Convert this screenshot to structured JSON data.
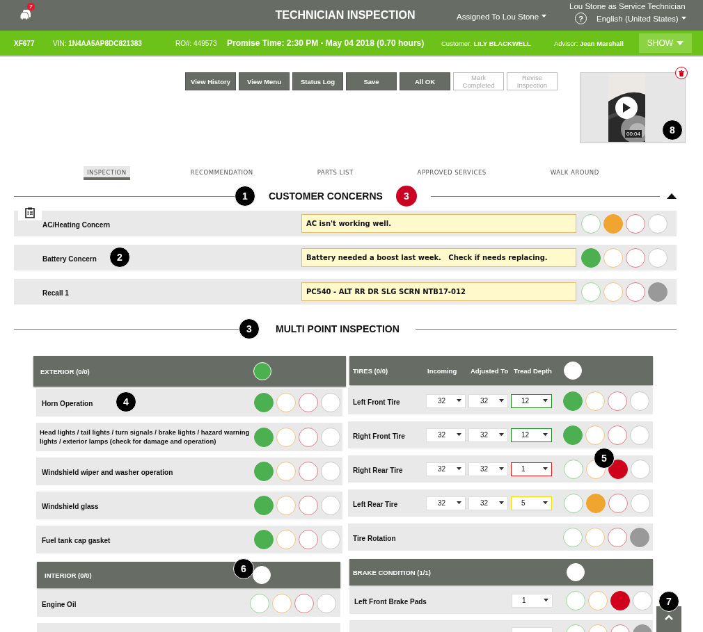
{
  "header": {
    "notifications": "7",
    "title": "TECHNICIAN INSPECTION",
    "assigned": "Assigned To Lou Stone",
    "user": "Lou Stone as Service Technician",
    "help": "?",
    "language": "English (United States)"
  },
  "info_bar": {
    "tag": "XF677",
    "vin": "VIN: **1N4AA5AP8DC821383**",
    "ro": "RO#: 449573",
    "promise": "Promise Time: 2:30 PM - May 04 2018 (0.70 hours)",
    "customer": "Customer: **LILY BLACKWELL**",
    "advisor": "Advisor: **Jean Marshall**",
    "show": "SHOW"
  },
  "actions": [
    {
      "label": "View History",
      "disabled": false
    },
    {
      "label": "View Menu",
      "disabled": false
    },
    {
      "label": "Status Log",
      "disabled": false
    },
    {
      "label": "Save",
      "disabled": false
    },
    {
      "label": "All OK",
      "disabled": false
    },
    {
      "label": "Mark Completed",
      "disabled": true
    },
    {
      "label": "Revise Inspection",
      "disabled": true
    }
  ],
  "video": {
    "duration": "00:04",
    "callout": "8"
  },
  "tabs": [
    {
      "label": "INSPECTION",
      "selected": true
    },
    {
      "label": "RECOMMENDATION",
      "selected": false
    },
    {
      "label": "PARTS LIST",
      "selected": false
    },
    {
      "label": "APPROVED SERVICES",
      "selected": false
    },
    {
      "label": "WALK AROUND",
      "selected": false
    }
  ],
  "concerns": {
    "title": "CUSTOMER CONCERNS",
    "callout": "1",
    "count": "3",
    "expanded": true,
    "items": [
      {
        "name": "AC/Heating Concern",
        "note": "AC isn't working well.",
        "ratings": [
          {
            "kind": "good",
            "selected": false
          },
          {
            "kind": "warning",
            "selected": true
          },
          {
            "kind": "urgent",
            "selected": false
          },
          {
            "kind": "na",
            "selected": false
          }
        ]
      },
      {
        "name": "Battery Concern",
        "note": "Battery needed a boost last week.   Check if needs replacing.",
        "callout": "2",
        "ratings": [
          {
            "kind": "good",
            "selected": true
          },
          {
            "kind": "warning",
            "selected": false
          },
          {
            "kind": "urgent",
            "selected": false
          },
          {
            "kind": "na",
            "selected": false
          }
        ]
      },
      {
        "name": "Recall 1",
        "note": "PC540 - ALT RR DR SLG SCRN NTB17-012",
        "ratings": [
          {
            "kind": "good",
            "selected": false
          },
          {
            "kind": "warning",
            "selected": false
          },
          {
            "kind": "urgent",
            "selected": false
          },
          {
            "kind": "na",
            "selected": true
          }
        ]
      }
    ]
  },
  "mpi": {
    "title": "MULTI POINT INSPECTION",
    "callout": "3"
  },
  "exterior": {
    "title": "EXTERIOR (0/0)",
    "color": "#4caf50",
    "items": [
      {
        "name": "Horn Operation",
        "callout": "4",
        "ratings": [
          {
            "kind": "good",
            "selected": true
          },
          {
            "kind": "warning",
            "selected": false
          },
          {
            "kind": "urgent",
            "selected": false
          },
          {
            "kind": "na",
            "selected": false
          }
        ]
      },
      {
        "name": "Head lights / tail lights / turn signals / brake lights / hazard warning lights / exterior lamps (check for damage and operation)",
        "ratings": [
          {
            "kind": "good",
            "selected": true
          },
          {
            "kind": "warning",
            "selected": false
          },
          {
            "kind": "urgent",
            "selected": false
          },
          {
            "kind": "na",
            "selected": false
          }
        ]
      },
      {
        "name": "Windshield wiper and washer operation",
        "ratings": [
          {
            "kind": "good",
            "selected": true
          },
          {
            "kind": "warning",
            "selected": false
          },
          {
            "kind": "urgent",
            "selected": false
          },
          {
            "kind": "na",
            "selected": false
          }
        ]
      },
      {
        "name": "Windshield glass",
        "ratings": [
          {
            "kind": "good",
            "selected": true
          },
          {
            "kind": "warning",
            "selected": false
          },
          {
            "kind": "urgent",
            "selected": false
          },
          {
            "kind": "na",
            "selected": false
          }
        ]
      },
      {
        "name": "Fuel tank cap gasket",
        "ratings": [
          {
            "kind": "good",
            "selected": true
          },
          {
            "kind": "warning",
            "selected": false
          },
          {
            "kind": "urgent",
            "selected": false
          },
          {
            "kind": "na",
            "selected": false
          }
        ]
      }
    ]
  },
  "interior": {
    "title": "INTERIOR (0/0)",
    "color": "#ffffff",
    "callout": "6",
    "items": [
      {
        "name": "Engine Oil",
        "ratings": [
          {
            "kind": "good",
            "selected": false
          },
          {
            "kind": "warning",
            "selected": false
          },
          {
            "kind": "urgent",
            "selected": false
          },
          {
            "kind": "na",
            "selected": false
          }
        ]
      }
    ]
  },
  "tires": {
    "title": "TIRES (0/0)",
    "columns": [
      "Incoming",
      "Adjusted To",
      "Tread Depth"
    ],
    "color": "#ffffff",
    "items": [
      {
        "name": "Left Front Tire",
        "incoming": "32",
        "adjusted": "32",
        "tread": {
          "value": "12",
          "color": "#1e8a1e"
        },
        "ratings": [
          {
            "kind": "good",
            "selected": true
          },
          {
            "kind": "warning",
            "selected": false
          },
          {
            "kind": "urgent",
            "selected": false
          },
          {
            "kind": "na",
            "selected": false
          }
        ]
      },
      {
        "name": "Right Front Tire",
        "incoming": "32",
        "adjusted": "32",
        "tread": {
          "value": "12",
          "color": "#1e8a1e"
        },
        "ratings": [
          {
            "kind": "good",
            "selected": true
          },
          {
            "kind": "warning",
            "selected": false
          },
          {
            "kind": "urgent",
            "selected": false
          },
          {
            "kind": "na",
            "selected": false
          }
        ]
      },
      {
        "name": "Right Rear Tire",
        "incoming": "32",
        "adjusted": "32",
        "tread": {
          "value": "1",
          "color": "#e01818"
        },
        "callout": "5",
        "ratings": [
          {
            "kind": "good",
            "selected": false
          },
          {
            "kind": "warning",
            "selected": false
          },
          {
            "kind": "urgent",
            "selected": true
          },
          {
            "kind": "na",
            "selected": false
          }
        ]
      },
      {
        "name": "Left Rear Tire",
        "incoming": "32",
        "adjusted": "32",
        "tread": {
          "value": "5",
          "color": "#f0e000"
        },
        "ratings": [
          {
            "kind": "good",
            "selected": false
          },
          {
            "kind": "warning",
            "selected": true
          },
          {
            "kind": "urgent",
            "selected": false
          },
          {
            "kind": "na",
            "selected": false
          }
        ]
      },
      {
        "name": "Tire Rotation",
        "ratings": [
          {
            "kind": "good",
            "selected": false
          },
          {
            "kind": "warning",
            "selected": false
          },
          {
            "kind": "urgent",
            "selected": false
          },
          {
            "kind": "na",
            "selected": true
          }
        ]
      }
    ]
  },
  "brakes": {
    "title": "BRAKE CONDITION (1/1)",
    "color": "#ffffff",
    "items": [
      {
        "name": "Left Front Brake Pads",
        "value": "1",
        "ratings": [
          {
            "kind": "good",
            "selected": false
          },
          {
            "kind": "warning",
            "selected": false
          },
          {
            "kind": "urgent",
            "selected": true
          },
          {
            "kind": "na",
            "selected": false
          }
        ]
      },
      {
        "ratings": [
          {
            "kind": "good",
            "selected": false
          },
          {
            "kind": "warning",
            "selected": false
          },
          {
            "kind": "urgent",
            "selected": false
          },
          {
            "kind": "na",
            "selected": true
          }
        ]
      }
    ]
  },
  "scroll_top": {
    "callout": "7"
  }
}
